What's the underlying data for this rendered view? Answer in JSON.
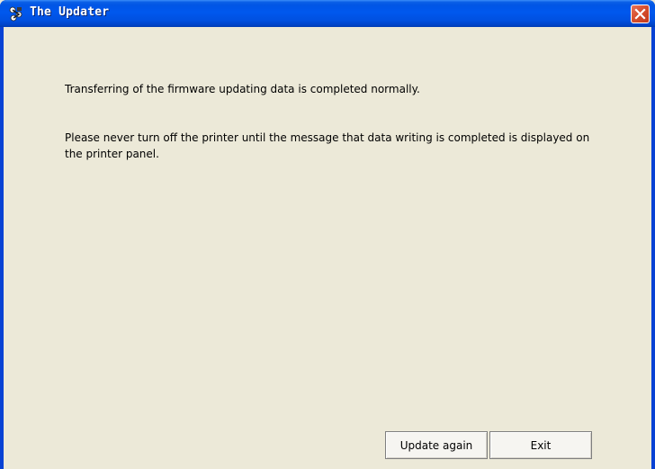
{
  "window": {
    "title": "The Updater",
    "title_color": "#ffffff",
    "titlebar_color": "#0055e5",
    "client_background": "#ece9d8",
    "icon": "app-icon",
    "close_icon": "close-icon"
  },
  "messages": {
    "line1": "Transferring of the firmware updating data is completed normally.",
    "line2": "Please never turn off the printer until the message that data writing is completed is displayed on the printer panel."
  },
  "buttons": {
    "update_again": "Update again",
    "exit": "Exit"
  }
}
